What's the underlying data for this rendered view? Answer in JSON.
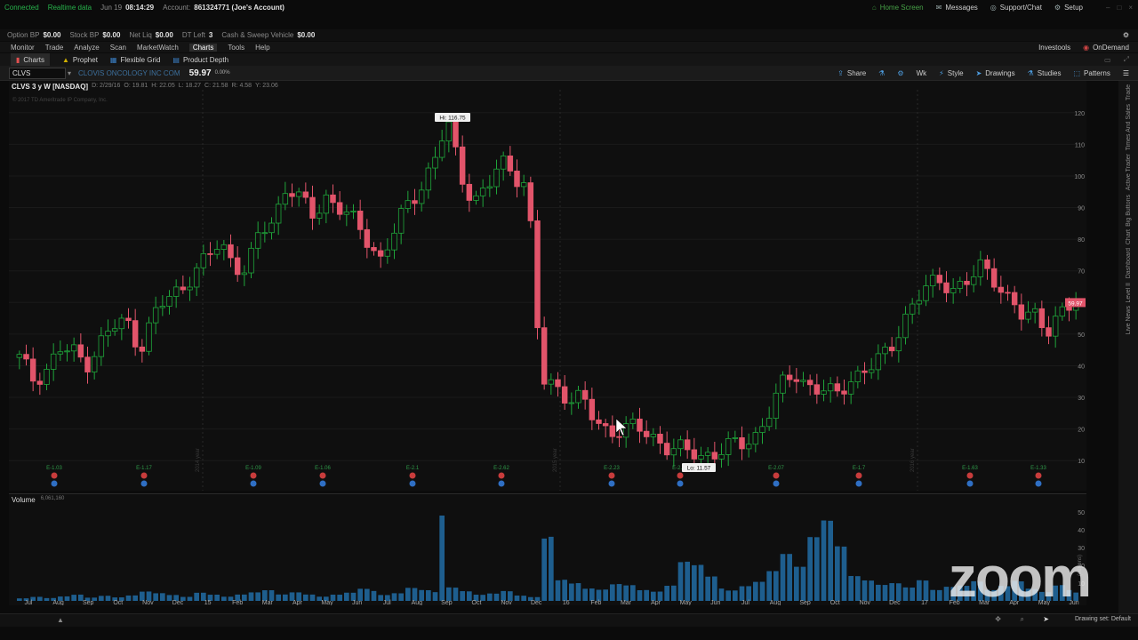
{
  "status": {
    "connected": "Connected",
    "realtime": "Realtime data",
    "date": "Jun 19",
    "time": "08:14:29",
    "account_label": "Account:",
    "account_value": "861324771 (Joe's Account)",
    "home_screen": "Home Screen",
    "messages": "Messages",
    "support": "Support/Chat",
    "setup": "Setup"
  },
  "account_bar": [
    {
      "label": "Option BP",
      "value": "$0.00"
    },
    {
      "label": "Stock BP",
      "value": "$0.00"
    },
    {
      "label": "Net Liq",
      "value": "$0.00"
    },
    {
      "label": "DT Left",
      "value": "3"
    },
    {
      "label": "Cash & Sweep Vehicle",
      "value": "$0.00"
    }
  ],
  "menu": [
    "Monitor",
    "Trade",
    "Analyze",
    "Scan",
    "MarketWatch",
    "Charts",
    "Tools",
    "Help"
  ],
  "menu_right": [
    "Investools",
    "OnDemand"
  ],
  "tabs": [
    "Charts",
    "Prophet",
    "Flexible Grid",
    "Product Depth"
  ],
  "symbol_bar": {
    "symbol": "CLVS",
    "company": "CLOVIS ONCOLOGY INC COM",
    "price": "59.97",
    "change": "0.00%",
    "tools": [
      "Share",
      "Wk",
      "Style",
      "Drawings",
      "Studies",
      "Patterns"
    ]
  },
  "chart_header": {
    "title": "CLVS 3 y W [NASDAQ]",
    "date": "D: 2/29/16",
    "open": "O: 19.81",
    "high": "H: 22.05",
    "low": "L: 18.27",
    "close": "C: 21.58",
    "change": "R: 4.58",
    "extra": "Y: 23.06",
    "copyright": "© 2017 TD Ameritrade IP Company, Inc."
  },
  "chart_annotations": {
    "hi_label": "Hi: 116.75",
    "lo_label": "Lo: 11.57",
    "price_label": "59.97"
  },
  "volume_header": {
    "label": "Volume",
    "value": "6,061,160"
  },
  "right_rail": [
    "Trade",
    "Times And Sales",
    "Active Trader",
    "Big Buttons",
    "Chart",
    "Dashboard",
    "Level II",
    "Live News"
  ],
  "footer": {
    "drawing_set": "Drawing set: Default"
  },
  "chart_data": {
    "type": "candlestick",
    "y_ticks": [
      10,
      20,
      30,
      40,
      50,
      60,
      70,
      80,
      90,
      100,
      110,
      120
    ],
    "volume_ticks": [
      10,
      20,
      30,
      40,
      50
    ],
    "volume_unit": "millions",
    "x_labels": [
      "Jul",
      "Aug",
      "Sep",
      "Oct",
      "Nov",
      "Dec",
      "15",
      "Feb",
      "Mar",
      "Apr",
      "May",
      "Jun",
      "Jul",
      "Aug",
      "Sep",
      "Oct",
      "Nov",
      "Dec",
      "16",
      "Feb",
      "Mar",
      "Apr",
      "May",
      "Jun",
      "Jul",
      "Aug",
      "Sep",
      "Oct",
      "Nov",
      "Dec",
      "17",
      "Feb",
      "Mar",
      "Apr",
      "May",
      "Jun"
    ],
    "earnings_labels": [
      "E-1.03",
      "E-1.17",
      "E-1.09",
      "E-1.06",
      "E-2.1",
      "E-2.62",
      "E-2.23",
      "E-2.13",
      "E-2.07",
      "E-1.7",
      "E-1.63",
      "E-1.33"
    ],
    "year_labels": [
      "2014 year",
      "2015 year",
      "2016 year"
    ],
    "price_path": [
      42,
      36,
      39,
      45,
      44,
      41,
      47,
      52,
      54,
      46,
      55,
      61,
      64,
      70,
      73,
      79,
      73,
      70,
      82,
      86,
      98,
      92,
      87,
      94,
      90,
      85,
      80,
      74,
      82,
      90,
      97,
      105,
      116.75,
      100,
      93,
      96,
      104,
      101,
      98,
      35,
      33,
      31,
      30,
      22,
      19,
      21,
      20,
      18,
      16,
      14,
      12,
      11.57,
      13,
      14,
      15,
      18,
      25,
      33,
      38,
      34,
      32,
      30,
      36,
      38,
      40,
      45,
      54,
      60,
      65,
      68,
      64,
      66,
      72,
      68,
      60,
      55,
      57,
      52,
      56,
      59.97
    ],
    "volume_path": [
      2,
      3,
      2,
      3,
      4,
      2,
      3,
      2,
      3,
      5,
      4,
      3,
      2,
      4,
      3,
      2,
      3,
      4,
      5,
      3,
      4,
      3,
      2,
      3,
      4,
      6,
      5,
      3,
      4,
      7,
      6,
      5,
      8,
      6,
      4,
      5,
      7,
      4,
      3,
      48,
      15,
      12,
      8,
      7,
      10,
      9,
      6,
      5,
      8,
      20,
      18,
      12,
      6,
      5,
      7,
      9,
      14,
      22,
      16,
      30,
      38,
      26,
      12,
      10,
      8,
      9,
      7,
      11,
      6,
      8,
      9,
      12,
      7,
      10,
      14,
      9,
      7,
      12,
      8,
      6
    ]
  }
}
